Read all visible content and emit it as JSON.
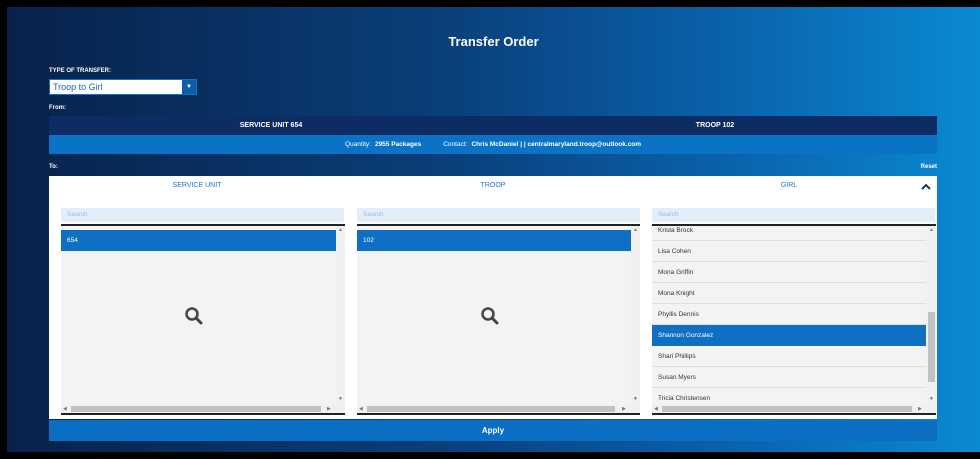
{
  "dialog": {
    "title": "Transfer Order"
  },
  "transfer_type": {
    "label": "TYPE OF TRANSFER:",
    "selected": "Troop to Girl"
  },
  "from": {
    "label": "From:",
    "service_unit": "SERVICE UNIT 654",
    "troop": "TROOP 102",
    "quantity_label": "Quantity:",
    "quantity_value": "2955 Packages",
    "contact_label": "Contact:",
    "contact_value": "Chris McDaniel | | centralmaryland.troop@outlook.com"
  },
  "to": {
    "label": "To:",
    "reset_label": "Reset",
    "columns": {
      "service_unit": {
        "header": "SERVICE UNIT",
        "placeholder": "Search",
        "items": [
          "654"
        ],
        "selected_index": 0
      },
      "troop": {
        "header": "TROOP",
        "placeholder": "Search",
        "items": [
          "102"
        ],
        "selected_index": 0
      },
      "girl": {
        "header": "GIRL",
        "placeholder": "Search",
        "items": [
          "Krista Brock",
          "Lisa Cohen",
          "Mona Griffin",
          "Mona Knight",
          "Phyllis Dennis",
          "Shannon Gonzalez",
          "Shari Phillips",
          "Susan Myers",
          "Tricia Christensen"
        ],
        "selected_index": 5,
        "scroll_position": 0.62
      }
    }
  },
  "actions": {
    "apply_label": "Apply"
  },
  "colors": {
    "accent": "#0a6fc3",
    "header_bar": "#0c2c63",
    "selection": "#0e6fc3"
  },
  "icons": {
    "collapse": "chevron-up-icon",
    "empty_search": "magnifier-icon",
    "dropdown": "caret-down-icon"
  }
}
